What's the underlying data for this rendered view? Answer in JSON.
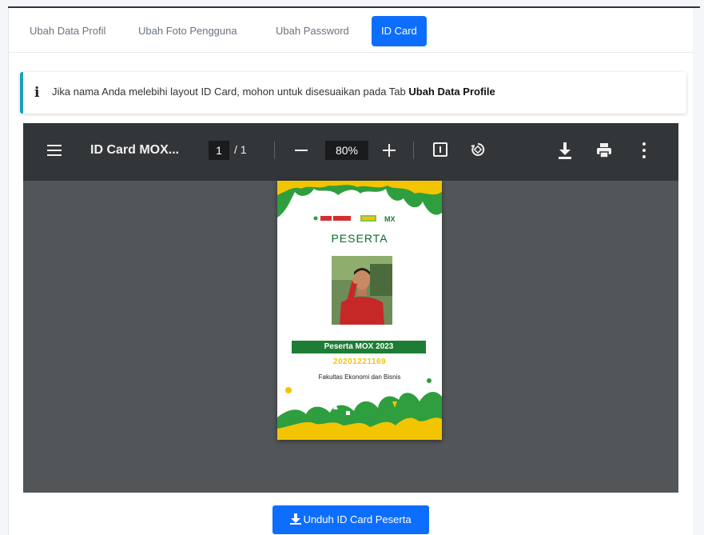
{
  "tabs": [
    {
      "label": "Ubah Data Profil",
      "active": false
    },
    {
      "label": "Ubah Foto Pengguna",
      "active": false
    },
    {
      "label": "Ubah Password",
      "active": false
    },
    {
      "label": "ID Card",
      "active": true
    }
  ],
  "alert": {
    "icon": "info-icon",
    "text": "Jika nama Anda melebihi layout ID Card, mohon untuk disesuaikan pada Tab ",
    "bold": "Ubah Data Profile"
  },
  "pdf_viewer": {
    "title": "ID Card MOX...",
    "page_current": "1",
    "page_total": "/ 1",
    "zoom": "80%",
    "icons": [
      "menu-icon",
      "minus-icon",
      "plus-icon",
      "fit-page-icon",
      "rotate-icon",
      "download-icon",
      "print-icon",
      "more-options-icon"
    ]
  },
  "id_card": {
    "role": "PESERTA",
    "name": "Peserta MOX 2023",
    "nim": "20201221169",
    "faculty": "Fakultas Ekonomi dan Bisnis",
    "logo_text": "MX"
  },
  "download_button": {
    "label": "Unduh ID Card Peserta",
    "icon": "download-icon"
  },
  "colors": {
    "primary": "#0d6efd",
    "alert_border": "#17a2b8",
    "viewer_toolbar": "#323639",
    "viewer_bg": "#525659",
    "card_green": "#1e7d34",
    "card_yellow": "#f2c500"
  }
}
